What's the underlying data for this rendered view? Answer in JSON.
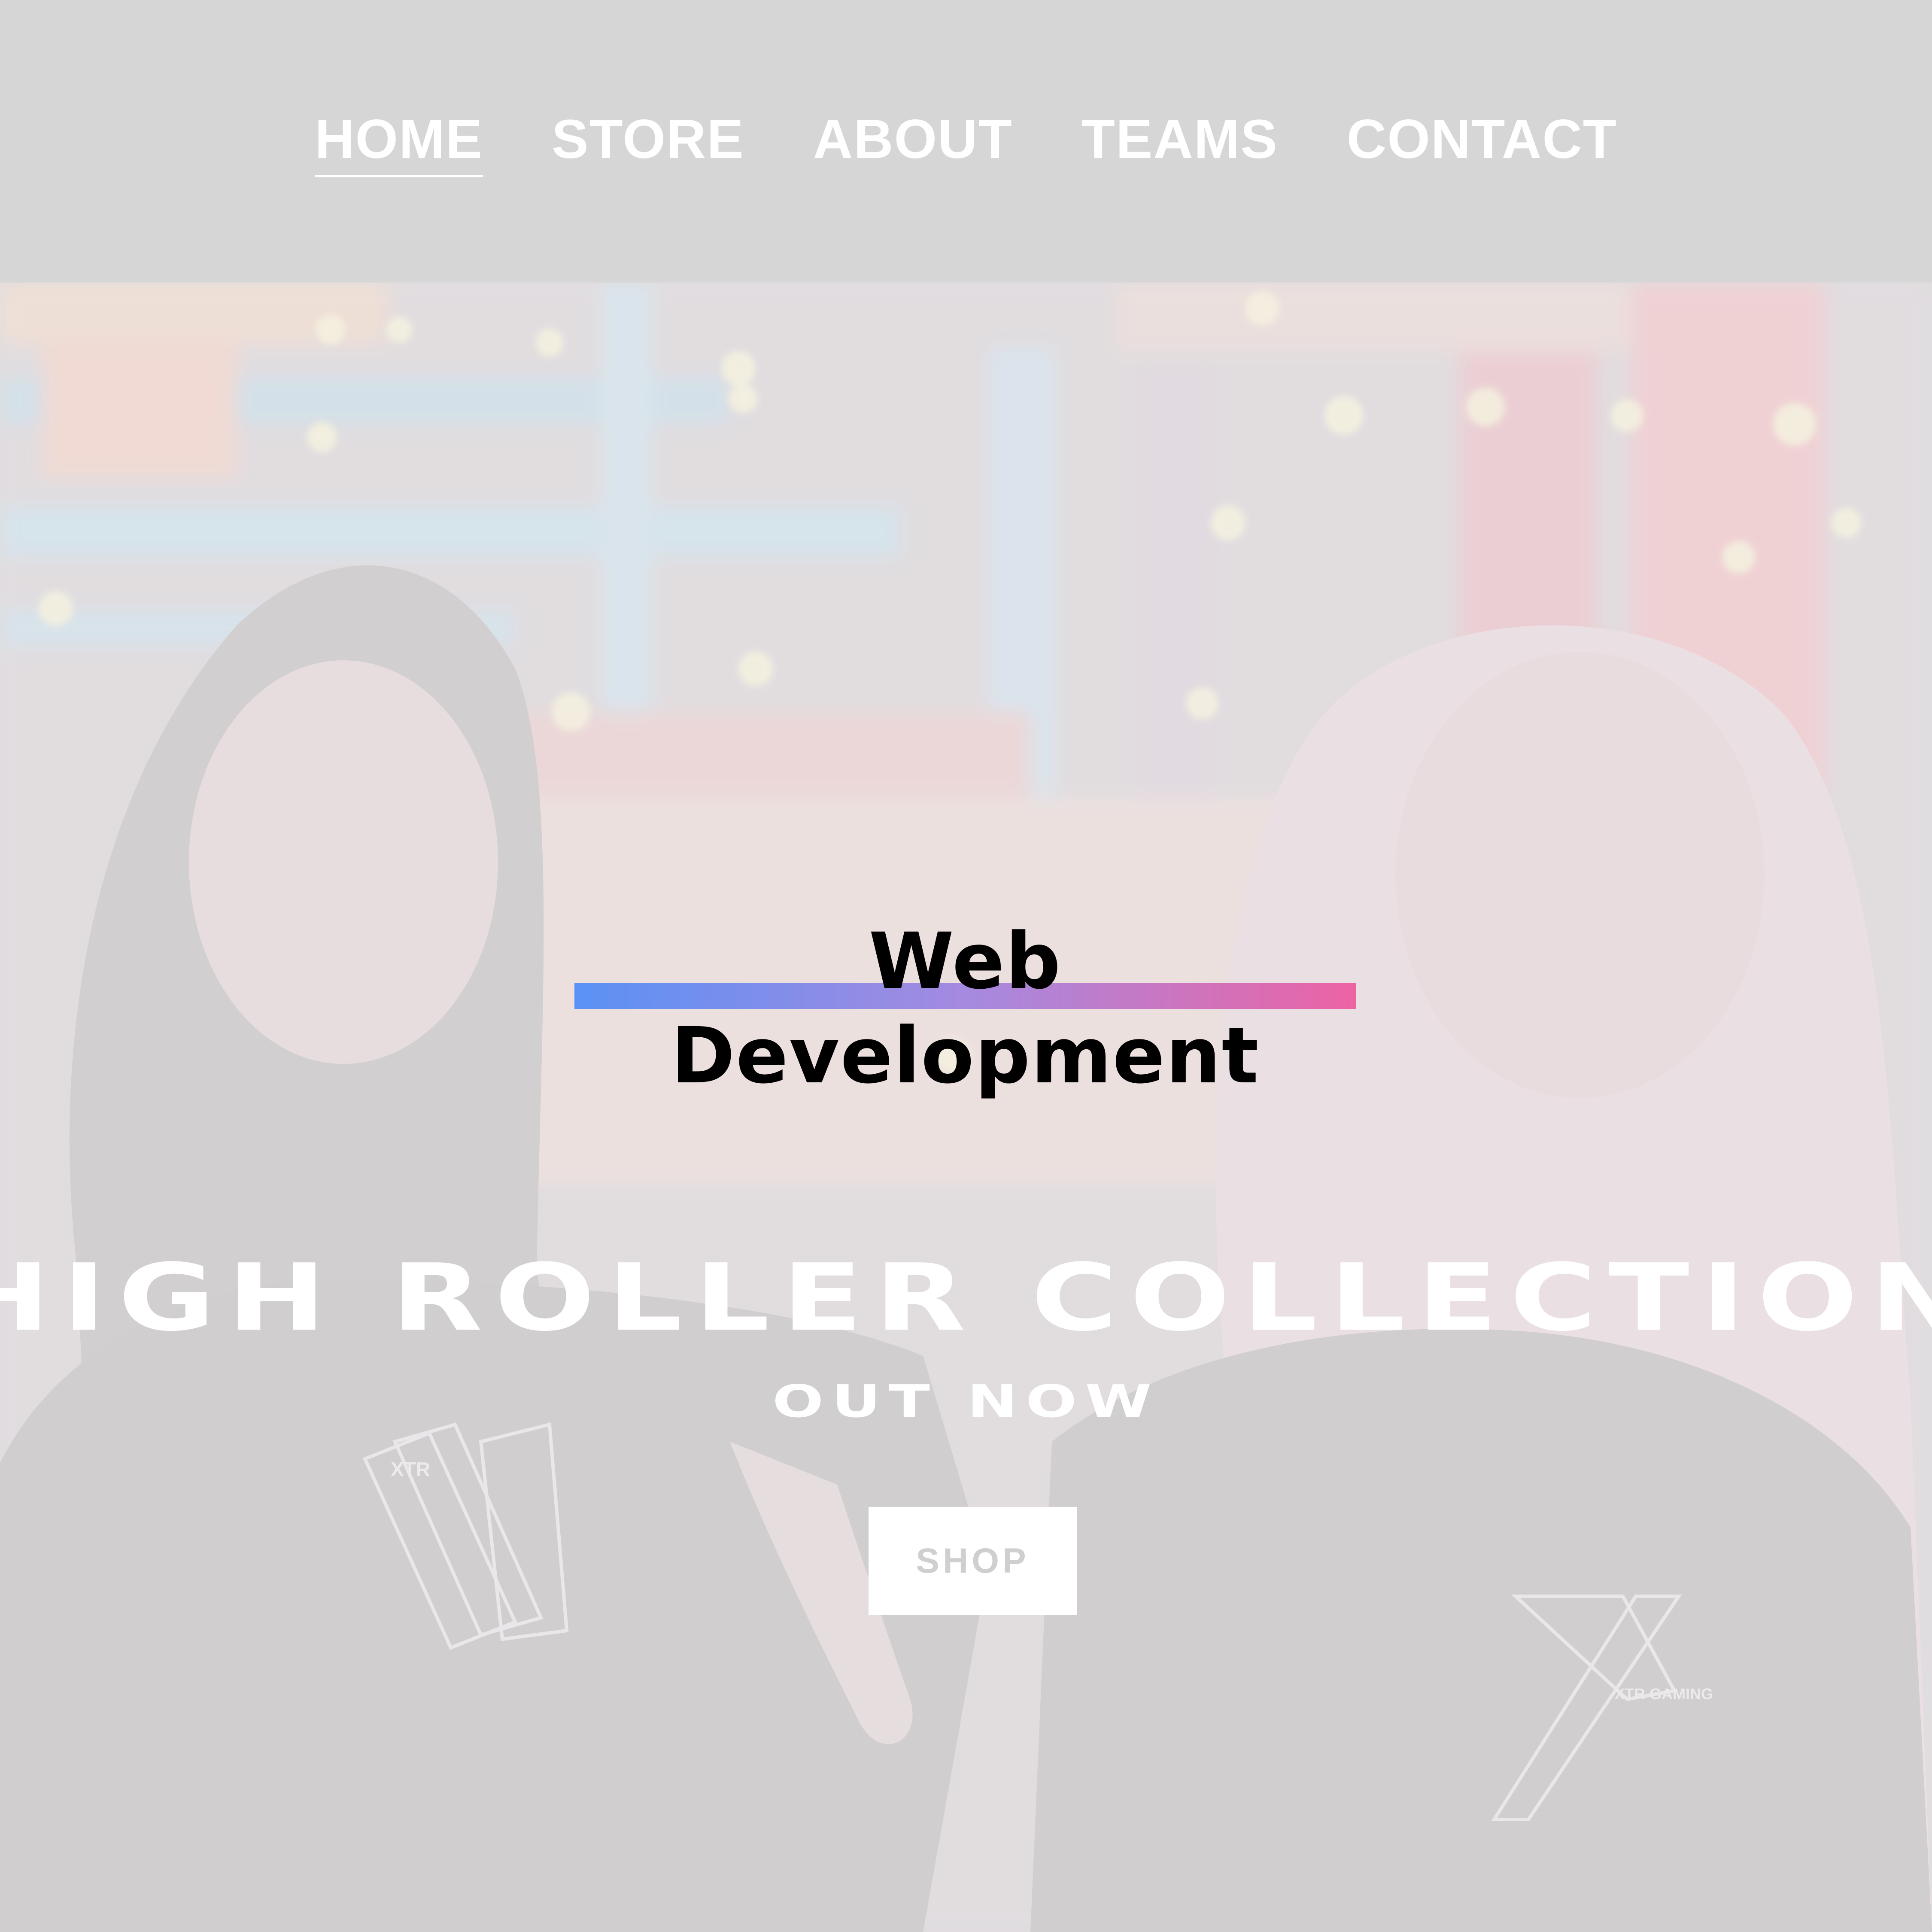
{
  "nav": {
    "items": [
      {
        "label": "HOME",
        "active": true
      },
      {
        "label": "STORE",
        "active": false
      },
      {
        "label": "ABOUT",
        "active": false
      },
      {
        "label": "TEAMS",
        "active": false
      },
      {
        "label": "CONTACT",
        "active": false
      }
    ]
  },
  "hero": {
    "title": "HIGH ROLLER COLLECTION",
    "subtitle": "OUT NOW",
    "button_label": "SHOP",
    "shirt_print_left": "XTR",
    "shirt_print_right": "XTR GAMING"
  },
  "overlay": {
    "label": "Web Development",
    "gradient_start": "#5b91f5",
    "gradient_end": "#ec63a4"
  },
  "colors": {
    "nav_bg": "#d6d6d6",
    "text": "#ffffff",
    "button_bg": "#ffffff",
    "button_text": "#cfcfcf"
  }
}
